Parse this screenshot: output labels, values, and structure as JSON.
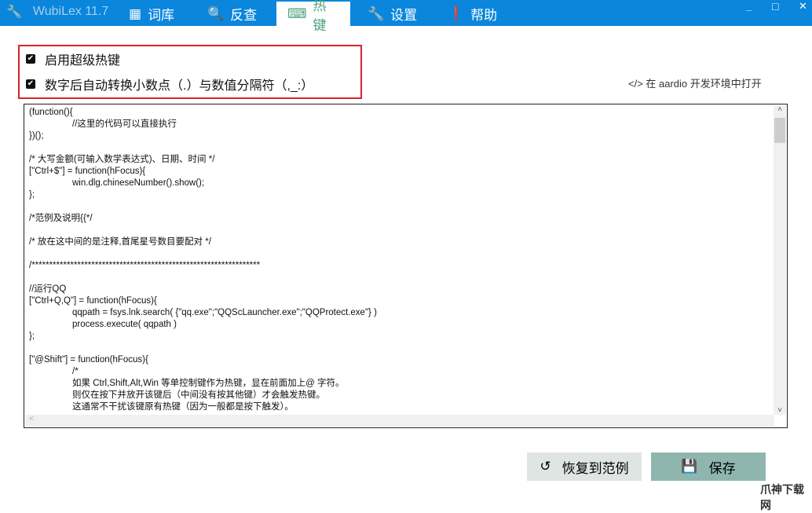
{
  "app": {
    "title": "WubiLex 11.7",
    "icon": "wrench-icon"
  },
  "tabs": [
    {
      "label": "词库",
      "icon": "grid-icon"
    },
    {
      "label": "反查",
      "icon": "search-icon"
    },
    {
      "label": "热键",
      "icon": "keyboard-icon",
      "active": true
    },
    {
      "label": "设置",
      "icon": "wrench-icon"
    },
    {
      "label": "帮助",
      "icon": "exclamation-icon"
    }
  ],
  "window_controls": {
    "minimize": "_",
    "maximize": "□",
    "close": "✕"
  },
  "options": [
    {
      "label": "启用超级热键",
      "checked": true
    },
    {
      "label": "数字后自动转换小数点（.）与数值分隔符（,_:）",
      "checked": true
    }
  ],
  "aardio_link": "</> 在 aardio 开发环境中打开",
  "code_lines": [
    {
      "t": "(function(){",
      "i": 0
    },
    {
      "t": "//这里的代码可以直接执行",
      "i": 1
    },
    {
      "t": "})();",
      "i": 0
    },
    {
      "t": "",
      "i": 0
    },
    {
      "t": "/* 大写金额(可输入数学表达式)、日期、时间 */",
      "i": 0
    },
    {
      "t": "[\"Ctrl+$\"] = function(hFocus){",
      "i": 0
    },
    {
      "t": "win.dlg.chineseNumber().show();",
      "i": 1
    },
    {
      "t": "};",
      "i": 0
    },
    {
      "t": "",
      "i": 0
    },
    {
      "t": "/*范例及说明{{*/",
      "i": 0
    },
    {
      "t": "",
      "i": 0
    },
    {
      "t": "/* 放在这中间的是注释,首尾星号数目要配对 */",
      "i": 0
    },
    {
      "t": "",
      "i": 0
    },
    {
      "t": "/*****************************************************************",
      "i": 0
    },
    {
      "t": "",
      "i": 0
    },
    {
      "t": "//运行QQ",
      "i": 0
    },
    {
      "t": "[\"Ctrl+Q,Q\"] = function(hFocus){",
      "i": 0
    },
    {
      "t": "qqpath = fsys.lnk.search( {\"qq.exe\";\"QQScLauncher.exe\";\"QQProtect.exe\"} )",
      "i": 1
    },
    {
      "t": "process.execute( qqpath )",
      "i": 1
    },
    {
      "t": "};",
      "i": 0
    },
    {
      "t": "",
      "i": 0
    },
    {
      "t": "[\"@Shift\"] = function(hFocus){",
      "i": 0
    },
    {
      "t": "/*",
      "i": 1
    },
    {
      "t": "如果 Ctrl,Shift,Alt,Win 等单控制键作为热键，显在前面加上@ 字符。",
      "i": 1
    },
    {
      "t": "则仅在按下并放开该键后（中间没有按其他键）才会触发热键。",
      "i": 1
    },
    {
      "t": "这通常不干扰该键原有热键（因为一般都是按下触发）。",
      "i": 1
    }
  ],
  "buttons": {
    "restore": "恢复到范例",
    "save": "保存"
  },
  "watermark": "爪神下载网",
  "colors": {
    "titlebar": "#0a86dc",
    "active_tab": "#4aa27a",
    "save_button": "#8fb6ae",
    "highlight_box": "#d9232e"
  }
}
